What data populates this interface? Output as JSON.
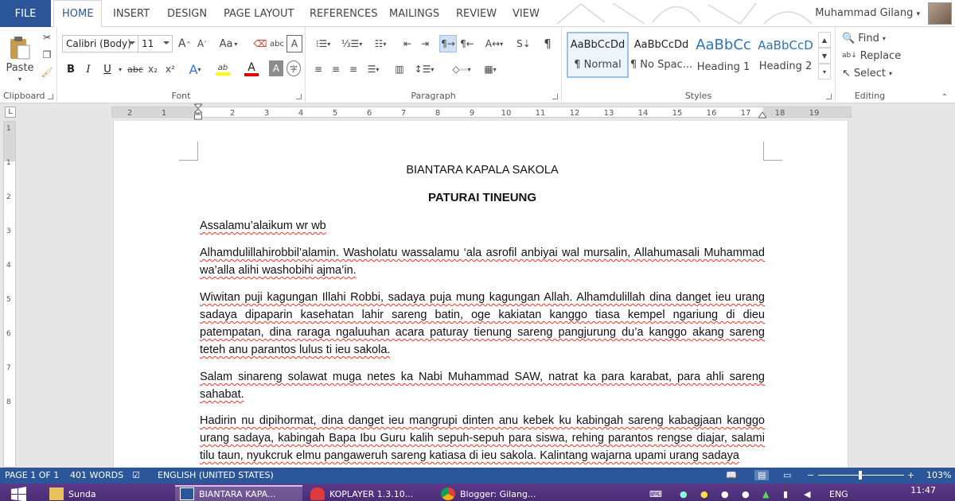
{
  "tabs": {
    "file": "FILE",
    "items": [
      "HOME",
      "INSERT",
      "DESIGN",
      "PAGE LAYOUT",
      "REFERENCES",
      "MAILINGS",
      "REVIEW",
      "VIEW"
    ],
    "active": "HOME"
  },
  "user": {
    "name": "Muhammad Gilang"
  },
  "ribbon": {
    "clipboard": {
      "label": "Clipboard",
      "paste": "Paste"
    },
    "font": {
      "label": "Font",
      "name": "Calibri (Body)",
      "size": "11",
      "grow": "A",
      "shrink": "A",
      "case": "Aa",
      "bold": "B",
      "italic": "I",
      "underline": "U",
      "strike": "abc",
      "sub": "x₂",
      "sup": "x²",
      "effects": "A",
      "highlight": "ab",
      "color": "A",
      "shade": "A",
      "enclose": "字"
    },
    "paragraph": {
      "label": "Paragraph"
    },
    "styles": {
      "label": "Styles",
      "items": [
        {
          "sample": "AaBbCcDd",
          "name": "¶ Normal",
          "color": "#222222"
        },
        {
          "sample": "AaBbCcDd",
          "name": "¶ No Spac...",
          "color": "#222222"
        },
        {
          "sample": "AaBbCc",
          "name": "Heading 1",
          "color": "#2e74b5"
        },
        {
          "sample": "AaBbCcD",
          "name": "Heading 2",
          "color": "#2e74b5"
        }
      ]
    },
    "editing": {
      "label": "Editing",
      "find": "Find",
      "replace": "Replace",
      "select": "Select"
    }
  },
  "ruler": {
    "ticks": [
      "2",
      "1",
      "1",
      "2",
      "3",
      "4",
      "5",
      "6",
      "7",
      "8",
      "9",
      "10",
      "11",
      "12",
      "13",
      "14",
      "15",
      "16",
      "17",
      "18",
      "19"
    ],
    "vticks": [
      "1",
      "1",
      "2",
      "3",
      "4",
      "5",
      "6",
      "7",
      "8"
    ]
  },
  "document": {
    "title": "BIANTARA KAPALA SAKOLA",
    "heading": "PATURAI TINEUNG",
    "greeting": "Assalamu’alaikum wr wb",
    "p1": "Alhamdulillahirobbil’alamin. Washolatu wassalamu ‘ala asrofil anbiyai wal mursalin, Allahumasali Muhammad wa’alla alihi washobihi ajma’in.",
    "p2": "Wiwitan puji kagungan Illahi Robbi, sadaya puja mung kagungan Allah. Alhamdulillah dina danget ieu urang sadaya dipaparin kasehatan lahir sareng batin, oge kakiatan kanggo tiasa kempel ngariung di dieu patempatan, dina raraga ngaluuhan acara paturay tienung sareng pangjurung du’a kanggo akang sareng teteh anu parantos lulus ti ieu sakola.",
    "p3": "Salam sinareng solawat muga netes ka Nabi Muhammad SAW, natrat ka para karabat, para ahli sareng sahabat.",
    "p4": "Hadirin nu dipihormat, dina danget ieu mangrupi dinten anu kebek ku kabingah sareng kabagjaan kanggo urang sadaya, kabingah Bapa Ibu Guru kalih sepuh-sepuh para siswa, rehing parantos rengse diajar, salami tilu taun, nyukcruk elmu pangaweruh sareng katiasa di ieu sakola. Kalintang wajarna upami urang sadaya"
  },
  "status": {
    "page": "PAGE 1 OF 1",
    "words": "401 WORDS",
    "language": "ENGLISH (UNITED STATES)",
    "zoom": "103%"
  },
  "taskbar": {
    "items": [
      "Sunda",
      "BIANTARA KAPA...",
      "KOPLAYER 1.3.10...",
      "Blogger: Gilang..."
    ],
    "lang": "ENG",
    "time": "11:47"
  }
}
